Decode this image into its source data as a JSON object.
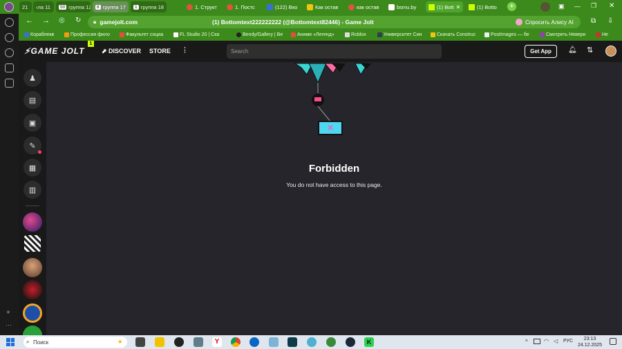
{
  "browser": {
    "tabs": [
      {
        "label": "21",
        "kind": "group"
      },
      {
        "label": "‹ла 11",
        "kind": "group"
      },
      {
        "label": "группа 12",
        "count": "50",
        "kind": "group"
      },
      {
        "label": "группа 17",
        "count": "8",
        "kind": "grey"
      },
      {
        "label": "группа 18",
        "count": "1",
        "kind": "group"
      },
      {
        "label": "1. Структ",
        "kind": "tab"
      },
      {
        "label": "1. Постс",
        "kind": "tab"
      },
      {
        "label": "(122) Вхо",
        "kind": "tab"
      },
      {
        "label": "Как остав",
        "kind": "tab"
      },
      {
        "label": "как остав",
        "kind": "tab"
      },
      {
        "label": "bsmu.by",
        "kind": "tab"
      },
      {
        "label": "(1) Bott",
        "kind": "active"
      },
      {
        "label": "(1) Botto",
        "kind": "tab"
      }
    ],
    "url": "gamejolt.com",
    "page_title": "(1) Bottomtext222222222 (@Bottomtext82446) - Game Jolt",
    "alice_button": "Спросить Алису AI",
    "bookmarks": [
      "Кораблекв",
      "Профессия фило",
      "Факультет социа",
      "FL Studio 20 | Ска",
      "Bendy/Gallery | Be",
      "Аниме «Легенд»",
      "Roblox",
      "Университет Син",
      "Скачать Construc",
      "PostImages — бе",
      "Смотреть Неверн",
      "Не"
    ],
    "colors": {
      "browser_green": "#3d8a1c",
      "page_bg": "#26252b",
      "header_bg": "#191919",
      "brand_accent": "#ccff00"
    }
  },
  "gamejolt": {
    "logo": "GAME JOLT",
    "logo_badge": "1",
    "nav": {
      "discover": "DISCOVER",
      "store": "STORE"
    },
    "search_placeholder": "Search",
    "get_app": "Get App",
    "rail_icons": [
      "user-icon",
      "store-icon",
      "bag-icon",
      "joystick-icon",
      "chat-icon",
      "library-icon"
    ],
    "forbidden": {
      "title": "Forbidden",
      "message": "You do not have access to this page."
    }
  },
  "taskbar": {
    "search_label": "Поиск",
    "lang": "РУС",
    "time": "23:13",
    "date": "24.12.2025"
  }
}
